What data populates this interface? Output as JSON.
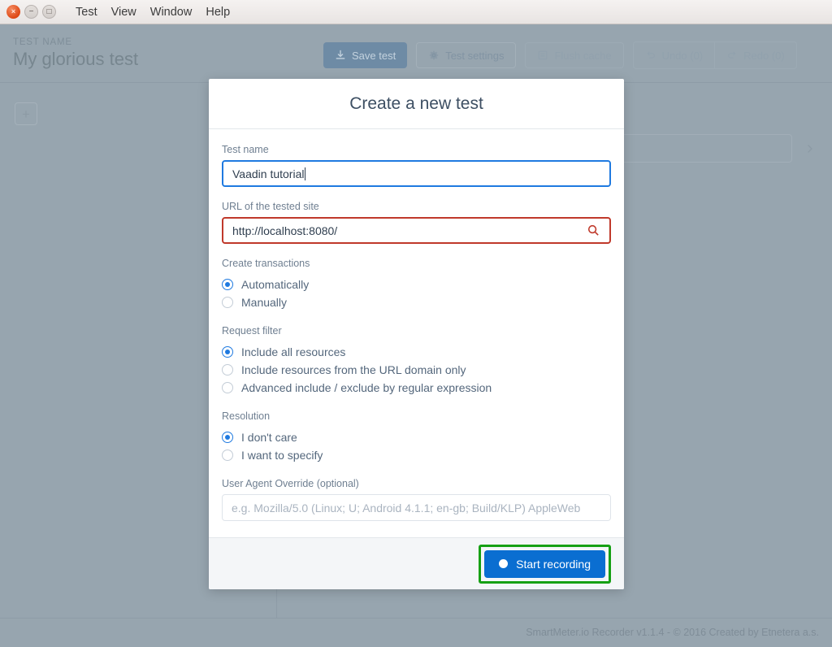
{
  "window": {
    "controls": {
      "close": "×",
      "minimize": "−",
      "maximize": "□"
    },
    "menus": [
      "Test",
      "View",
      "Window",
      "Help"
    ]
  },
  "header": {
    "test_name_label": "TEST NAME",
    "test_name_value": "My glorious test",
    "toolbar": {
      "save": "Save test",
      "settings": "Test settings",
      "flush_cache": "Flush cache",
      "undo": "Undo (0)",
      "redo": "Redo (0)"
    }
  },
  "workspace": {
    "add_button": "+",
    "chevron": "›"
  },
  "modal": {
    "title": "Create a new test",
    "test_name": {
      "label": "Test name",
      "value": "Vaadin tutorial"
    },
    "url": {
      "label": "URL of the tested site",
      "value": "http://localhost:8080/"
    },
    "transactions": {
      "label": "Create transactions",
      "options": [
        {
          "label": "Automatically",
          "selected": true
        },
        {
          "label": "Manually",
          "selected": false
        }
      ]
    },
    "request_filter": {
      "label": "Request filter",
      "options": [
        {
          "label": "Include all resources",
          "selected": true
        },
        {
          "label": "Include resources from the URL domain only",
          "selected": false
        },
        {
          "label": "Advanced include / exclude by regular expression",
          "selected": false
        }
      ]
    },
    "resolution": {
      "label": "Resolution",
      "options": [
        {
          "label": "I don't care",
          "selected": true
        },
        {
          "label": "I want to specify",
          "selected": false
        }
      ]
    },
    "user_agent": {
      "label": "User Agent Override (optional)",
      "placeholder": "e.g. Mozilla/5.0 (Linux; U; Android 4.1.1; en-gb; Build/KLP) AppleWeb",
      "value": ""
    },
    "start_recording": "Start recording"
  },
  "footer": {
    "text": "SmartMeter.io Recorder v1.1.4 - © 2016 Created by Etnetera a.s."
  },
  "colors": {
    "accent_blue": "#0a6ed1",
    "error_red": "#c0392b",
    "highlight_green": "#16a014",
    "app_bg": "#97a5af"
  }
}
